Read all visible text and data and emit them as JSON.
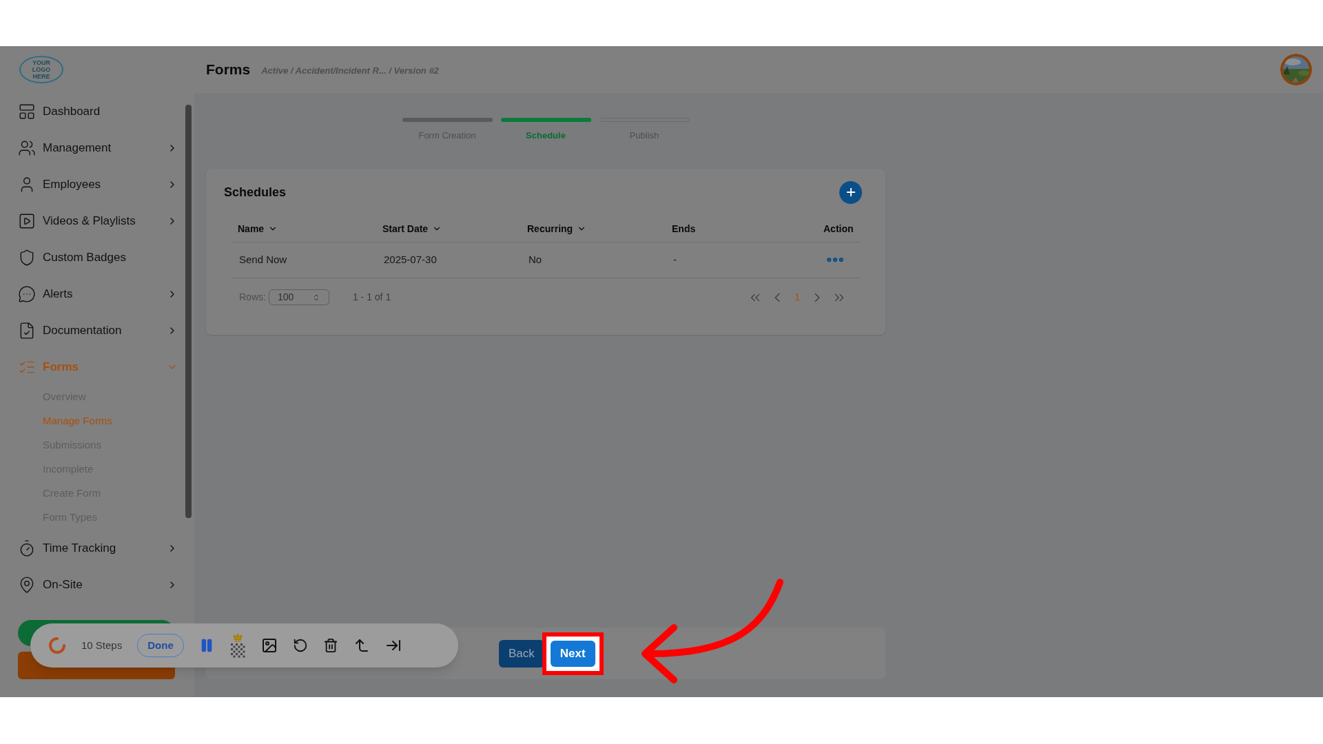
{
  "logo": {
    "text": "YOUR LOGO HERE"
  },
  "sidebar": {
    "items": [
      {
        "label": "Dashboard",
        "kind": "link",
        "selected": false
      },
      {
        "label": "Management",
        "kind": "group",
        "expanded": false,
        "selected": false
      },
      {
        "label": "Employees",
        "kind": "group",
        "expanded": false,
        "selected": false
      },
      {
        "label": "Videos & Playlists",
        "kind": "group",
        "expanded": false,
        "selected": false
      },
      {
        "label": "Custom Badges",
        "kind": "link",
        "selected": false
      },
      {
        "label": "Alerts",
        "kind": "group",
        "expanded": false,
        "selected": false
      },
      {
        "label": "Documentation",
        "kind": "group",
        "expanded": false,
        "selected": false
      },
      {
        "label": "Forms",
        "kind": "group",
        "expanded": true,
        "selected": true,
        "children": [
          {
            "label": "Overview",
            "selected": false
          },
          {
            "label": "Manage Forms",
            "selected": true
          },
          {
            "label": "Submissions",
            "selected": false
          },
          {
            "label": "Incomplete",
            "selected": false
          },
          {
            "label": "Create Form",
            "selected": false
          },
          {
            "label": "Form Types",
            "selected": false
          }
        ]
      },
      {
        "label": "Time Tracking",
        "kind": "group",
        "expanded": false,
        "selected": false
      },
      {
        "label": "On-Site",
        "kind": "group",
        "expanded": false,
        "selected": false
      }
    ]
  },
  "header": {
    "title": "Forms",
    "breadcrumb": "Active / Accident/Incident R... / Version #2"
  },
  "stepper": {
    "steps": [
      {
        "label": "Form Creation",
        "completed": true,
        "selected": false
      },
      {
        "label": "Schedule",
        "completed": false,
        "selected": true
      },
      {
        "label": "Publish",
        "completed": false,
        "selected": false
      }
    ]
  },
  "schedules": {
    "title": "Schedules",
    "columns": [
      {
        "label": "Name",
        "sortable": true
      },
      {
        "label": "Start Date",
        "sortable": true
      },
      {
        "label": "Recurring",
        "sortable": true
      },
      {
        "label": "Ends",
        "sortable": false
      },
      {
        "label": "Action",
        "sortable": false
      }
    ],
    "rows": [
      [
        "Send Now",
        "2025-07-30",
        "No",
        "-"
      ]
    ],
    "rows_label": "Rows:",
    "rows_value": "100",
    "range": "1 - 1 of 1",
    "page": "1"
  },
  "footer_buttons": [
    {
      "label": "Back",
      "highlighted": false
    },
    {
      "label": "Next",
      "highlighted": true
    }
  ],
  "recorder": {
    "steps": "10 Steps",
    "done": "Done"
  }
}
